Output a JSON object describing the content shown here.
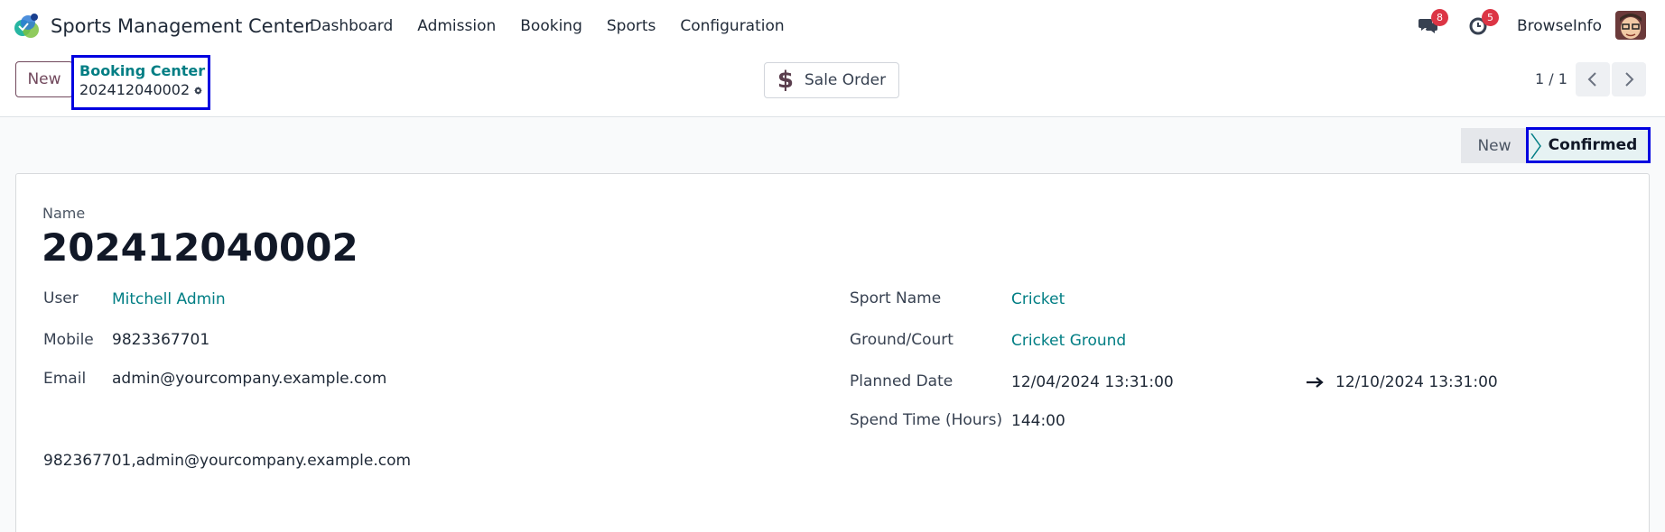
{
  "navbar": {
    "app_name": "Sports Management Center",
    "menu": [
      "Dashboard",
      "Admission",
      "Booking",
      "Sports",
      "Configuration"
    ],
    "messages_count": "8",
    "activities_count": "5",
    "company": "BrowseInfo",
    "badge_color": "#dc3545"
  },
  "control": {
    "new_label": "New",
    "breadcrumb_parent": "Booking Center",
    "breadcrumb_current": "202412040002",
    "smart_button_label": "Sale Order",
    "pager": "1 / 1"
  },
  "status": {
    "stages": [
      "New",
      "Confirmed"
    ],
    "current": "Confirmed"
  },
  "form": {
    "name_label": "Name",
    "name": "202412040002",
    "user_label": "User",
    "user": "Mitchell Admin",
    "mobile_label": "Mobile",
    "mobile": "9823367701",
    "email_label": "Email",
    "email": "admin@yourcompany.example.com",
    "contact_line": "982367701,admin@yourcompany.example.com",
    "sport_label": "Sport Name",
    "sport": "Cricket",
    "ground_label": "Ground/Court",
    "ground": "Cricket Ground",
    "planned_label": "Planned Date",
    "planned_start": "12/04/2024 13:31:00",
    "planned_end": "12/10/2024 13:31:00",
    "spend_label": "Spend Time (Hours)",
    "spend": "144:00"
  },
  "colors": {
    "accent": "#017e84",
    "brand": "#71485c",
    "highlight_border": "#0000e0"
  }
}
